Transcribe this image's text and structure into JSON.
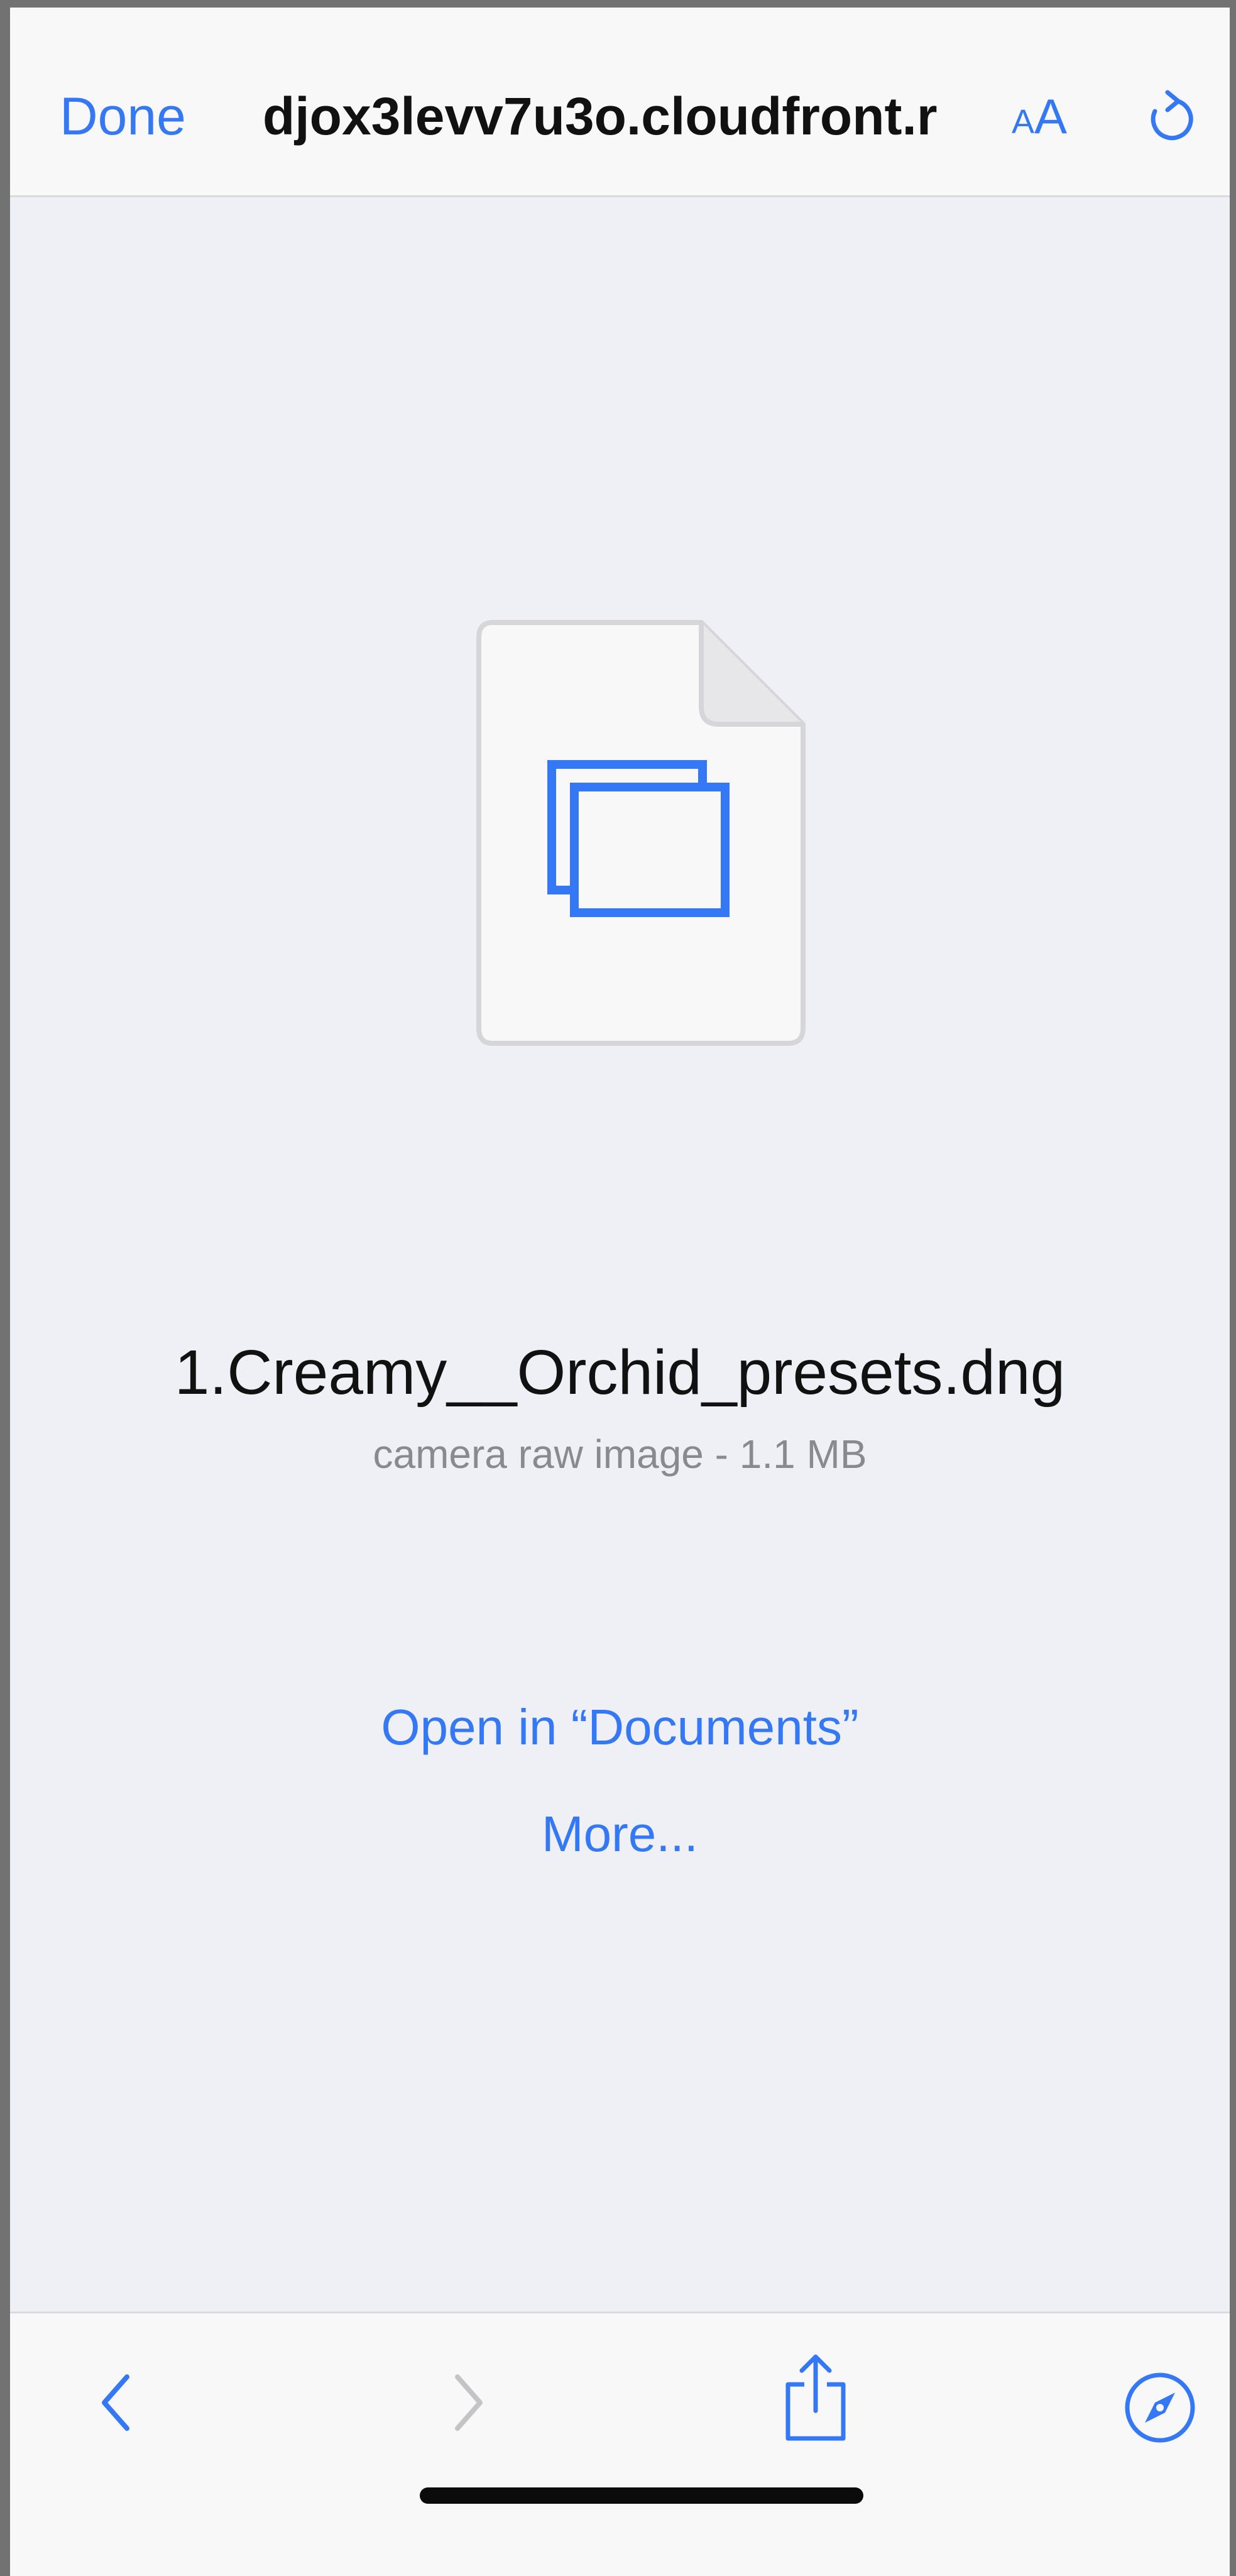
{
  "nav": {
    "done_label": "Done",
    "url": "djox3levv7u3o.cloudfront.r",
    "aa_small": "A",
    "aa_big": "A"
  },
  "file": {
    "name": "1.Creamy__Orchid_presets.dng",
    "meta": "camera raw image - 1.1 MB"
  },
  "actions": {
    "open_in": "Open in “Documents”",
    "more": "More..."
  },
  "icons": {
    "reload": "reload-icon",
    "back": "chevron-left-icon",
    "forward": "chevron-right-icon",
    "share": "share-icon",
    "compass": "compass-icon",
    "file": "document-icon"
  },
  "colors": {
    "accent": "#3478f6",
    "disabled": "#c4c4c7",
    "background": "#eff0f5",
    "bar": "#f8f8f9"
  }
}
